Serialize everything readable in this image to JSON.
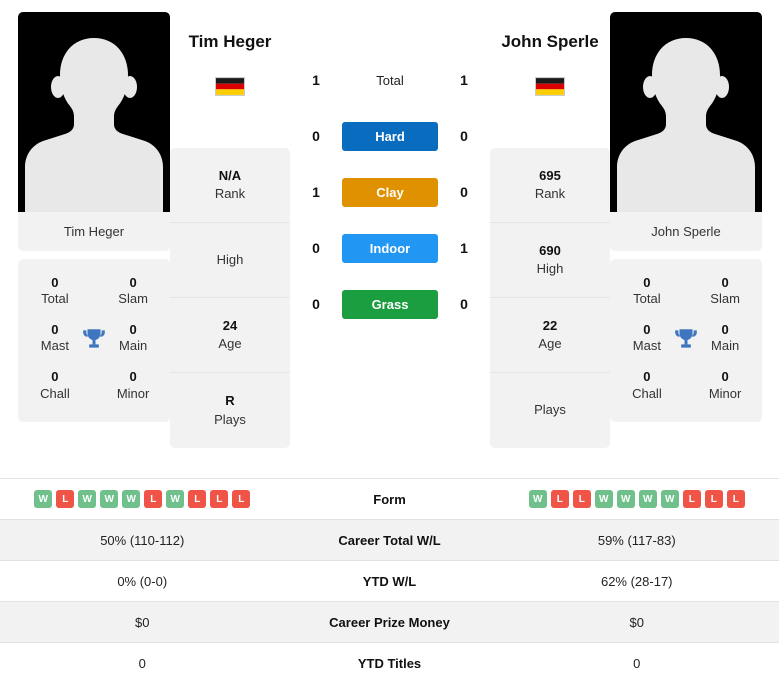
{
  "colors": {
    "hard": "#0a6cbe",
    "clay": "#e09100",
    "indoor": "#2196f3",
    "grass": "#1a9e3f",
    "win": "#6fc08a",
    "loss": "#f05446",
    "card_bg": "#f2f2f2"
  },
  "left_player": {
    "name": "Tim Heger",
    "photo_caption": "Tim Heger",
    "country": "Germany",
    "titles": {
      "total_value": "0",
      "total_label": "Total",
      "slam_value": "0",
      "slam_label": "Slam",
      "mast_value": "0",
      "mast_label": "Mast",
      "main_value": "0",
      "main_label": "Main",
      "chall_value": "0",
      "chall_label": "Chall",
      "minor_value": "0",
      "minor_label": "Minor"
    },
    "stats": [
      {
        "value": "N/A",
        "label": "Rank"
      },
      {
        "value": "",
        "label": "High"
      },
      {
        "value": "24",
        "label": "Age"
      },
      {
        "value": "R",
        "label": "Plays"
      }
    ],
    "form": [
      "W",
      "L",
      "W",
      "W",
      "W",
      "L",
      "W",
      "L",
      "L",
      "L"
    ],
    "career_total_wl": "50% (110-112)",
    "ytd_wl": "0% (0-0)",
    "career_prize_money": "$0",
    "ytd_titles": "0"
  },
  "right_player": {
    "name": "John Sperle",
    "photo_caption": "John Sperle",
    "country": "Germany",
    "titles": {
      "total_value": "0",
      "total_label": "Total",
      "slam_value": "0",
      "slam_label": "Slam",
      "mast_value": "0",
      "mast_label": "Mast",
      "main_value": "0",
      "main_label": "Main",
      "chall_value": "0",
      "chall_label": "Chall",
      "minor_value": "0",
      "minor_label": "Minor"
    },
    "stats": [
      {
        "value": "695",
        "label": "Rank"
      },
      {
        "value": "690",
        "label": "High"
      },
      {
        "value": "22",
        "label": "Age"
      },
      {
        "value": "",
        "label": "Plays"
      }
    ],
    "form": [
      "W",
      "L",
      "L",
      "W",
      "W",
      "W",
      "W",
      "L",
      "L",
      "L"
    ],
    "career_total_wl": "59% (117-83)",
    "ytd_wl": "62% (28-17)",
    "career_prize_money": "$0",
    "ytd_titles": "0"
  },
  "head_to_head": [
    {
      "label": "Total",
      "type": "text",
      "left": "1",
      "right": "1"
    },
    {
      "label": "Hard",
      "type": "badge",
      "left": "0",
      "right": "0",
      "color": "#0a6cbe"
    },
    {
      "label": "Clay",
      "type": "badge",
      "left": "1",
      "right": "0",
      "color": "#e09100"
    },
    {
      "label": "Indoor",
      "type": "badge",
      "left": "0",
      "right": "1",
      "color": "#2196f3"
    },
    {
      "label": "Grass",
      "type": "badge",
      "left": "0",
      "right": "0",
      "color": "#1a9e3f"
    }
  ],
  "table": {
    "rows": [
      {
        "label": "Form",
        "type": "form"
      },
      {
        "label": "Career Total W/L",
        "type": "text",
        "key": "career_total_wl"
      },
      {
        "label": "YTD W/L",
        "type": "text",
        "key": "ytd_wl"
      },
      {
        "label": "Career Prize Money",
        "type": "text",
        "key": "career_prize_money"
      },
      {
        "label": "YTD Titles",
        "type": "text",
        "key": "ytd_titles"
      }
    ]
  }
}
